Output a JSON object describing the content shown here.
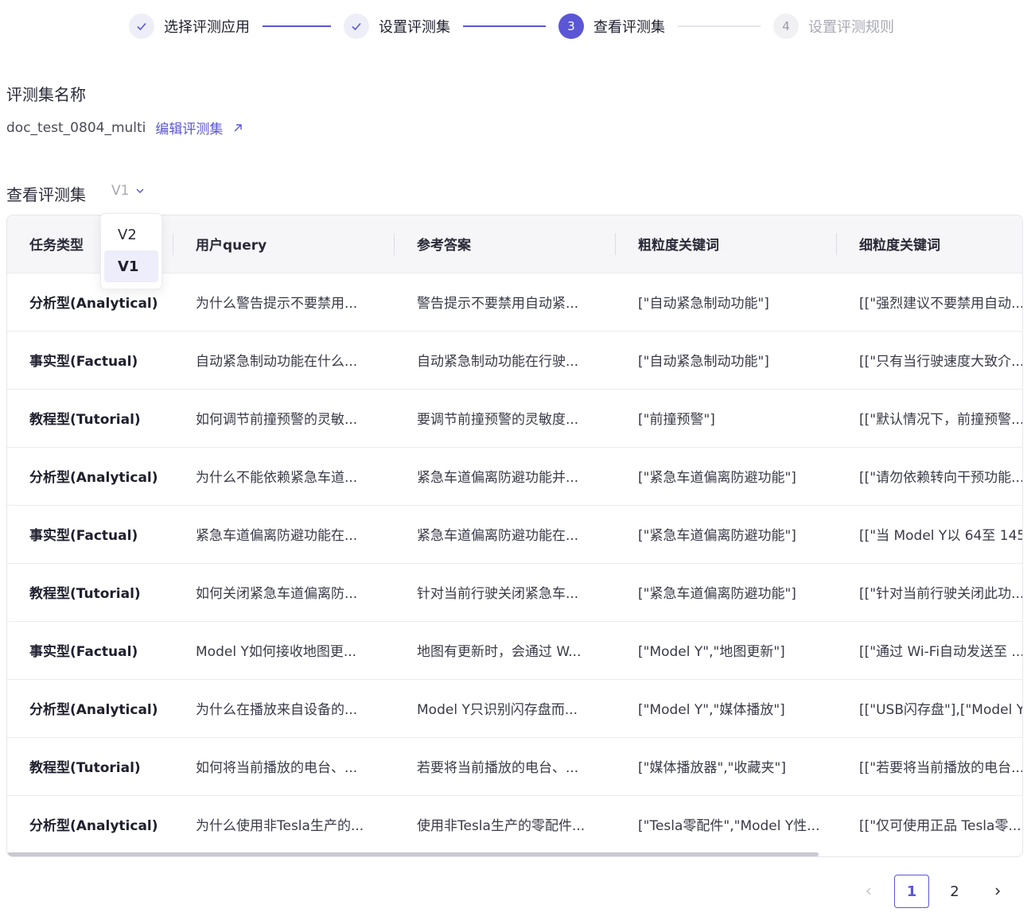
{
  "steps": [
    {
      "label": "选择评测应用",
      "state": "done",
      "marker": ""
    },
    {
      "label": "设置评测集",
      "state": "done",
      "marker": ""
    },
    {
      "label": "查看评测集",
      "state": "active",
      "marker": "3"
    },
    {
      "label": "设置评测规则",
      "state": "pending",
      "marker": "4"
    }
  ],
  "dataset": {
    "section_title": "评测集名称",
    "name": "doc_test_0804_multi",
    "edit_label": "编辑评测集"
  },
  "view": {
    "section_title": "查看评测集",
    "selected_version": "V1",
    "options": [
      "V2",
      "V1"
    ]
  },
  "table": {
    "columns": [
      "任务类型",
      "用户query",
      "参考答案",
      "粗粒度关键词",
      "细粒度关键词"
    ],
    "rows": [
      [
        "分析型(Analytical)",
        "为什么警告提示不要禁用...",
        "警告提示不要禁用自动紧...",
        "[\"自动紧急制动功能\"]",
        "[[\"强烈建议不要禁用自动..."
      ],
      [
        "事实型(Factual)",
        "自动紧急制动功能在什么...",
        "自动紧急制动功能在行驶...",
        "[\"自动紧急制动功能\"]",
        "[[\"只有当行驶速度大致介..."
      ],
      [
        "教程型(Tutorial)",
        "如何调节前撞预警的灵敏...",
        "要调节前撞预警的灵敏度...",
        "[\"前撞预警\"]",
        "[[\"默认情况下，前撞预警..."
      ],
      [
        "分析型(Analytical)",
        "为什么不能依赖紧急车道...",
        "紧急车道偏离防避功能并...",
        "[\"紧急车道偏离防避功能\"]",
        "[[\"请勿依赖转向干预功能..."
      ],
      [
        "事实型(Factual)",
        "紧急车道偏离防避功能在...",
        "紧急车道偏离防避功能在...",
        "[\"紧急车道偏离防避功能\"]",
        "[[\"当 Model Y以 64至 145"
      ],
      [
        "教程型(Tutorial)",
        "如何关闭紧急车道偏离防...",
        "针对当前行驶关闭紧急车...",
        "[\"紧急车道偏离防避功能\"]",
        "[[\"针对当前行驶关闭此功..."
      ],
      [
        "事实型(Factual)",
        "Model Y如何接收地图更...",
        "地图有更新时，会通过 W...",
        "[\"Model Y\",\"地图更新\"]",
        "[[\"通过 Wi-Fi自动发送至 ..."
      ],
      [
        "分析型(Analytical)",
        "为什么在播放来自设备的...",
        "Model Y只识别闪存盘而...",
        "[\"Model Y\",\"媒体播放\"]",
        "[[\"USB闪存盘\"],[\"Model Y"
      ],
      [
        "教程型(Tutorial)",
        "如何将当前播放的电台、...",
        "若要将当前播放的电台、...",
        "[\"媒体播放器\",\"收藏夹\"]",
        "[[\"若要将当前播放的电台..."
      ],
      [
        "分析型(Analytical)",
        "为什么使用非Tesla生产的...",
        "使用非Tesla生产的零配件...",
        "[\"Tesla零配件\",\"Model Y性...",
        "[[\"仅可使用正品 Tesla零..."
      ]
    ]
  },
  "pagination": {
    "pages": [
      "1",
      "2"
    ],
    "current": "1"
  }
}
